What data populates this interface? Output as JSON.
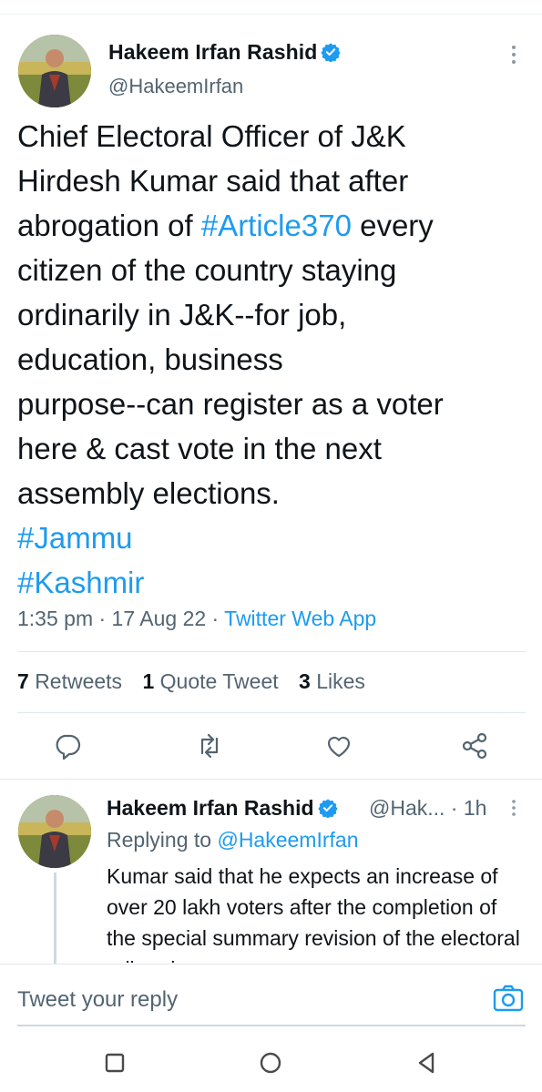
{
  "tweet": {
    "author_name": "Hakeem Irfan Rashid",
    "author_handle": "@HakeemIrfan",
    "body_parts": [
      {
        "text": "Chief Electoral Officer of J&K\nHirdesh Kumar said that after\nabrogation of ",
        "type": "text"
      },
      {
        "text": "#Article370",
        "type": "tag"
      },
      {
        "text": " every\ncitizen of the country staying\nordinarily in J&K--for job,\neducation,  business\npurpose--can register as a voter\nhere & cast vote in the next\nassembly elections.\n",
        "type": "text"
      },
      {
        "text": "#Jammu",
        "type": "tag"
      },
      {
        "text": "\n",
        "type": "text"
      },
      {
        "text": "#Kashmir",
        "type": "tag"
      }
    ],
    "time": "1:35 pm · 17 Aug 22 · ",
    "source": "Twitter Web App",
    "retweets_count": "7",
    "retweets_label": "Retweets",
    "quotes_count": "1",
    "quotes_label": "Quote Tweet",
    "likes_count": "3",
    "likes_label": "Likes"
  },
  "icons": {
    "reply": "reply-icon",
    "retweet": "retweet-icon",
    "like": "heart-icon",
    "share": "share-icon",
    "more": "more-vertical-icon",
    "verified": "verified-badge-icon",
    "camera": "camera-icon"
  },
  "reply": {
    "author_name": "Hakeem Irfan Rashid",
    "handle_time": "@Hak... · 1h",
    "replying_prefix": "Replying to ",
    "replying_mention": "@HakeemIrfan",
    "body": "Kumar said that he expects an increase of over 20 lakh voters after the completion of the special summary revision of the electoral roll and"
  },
  "compose": {
    "placeholder": "Tweet your reply"
  },
  "colors": {
    "accent": "#1d9bf0",
    "text": "#0f1419",
    "secondary": "#536471"
  }
}
